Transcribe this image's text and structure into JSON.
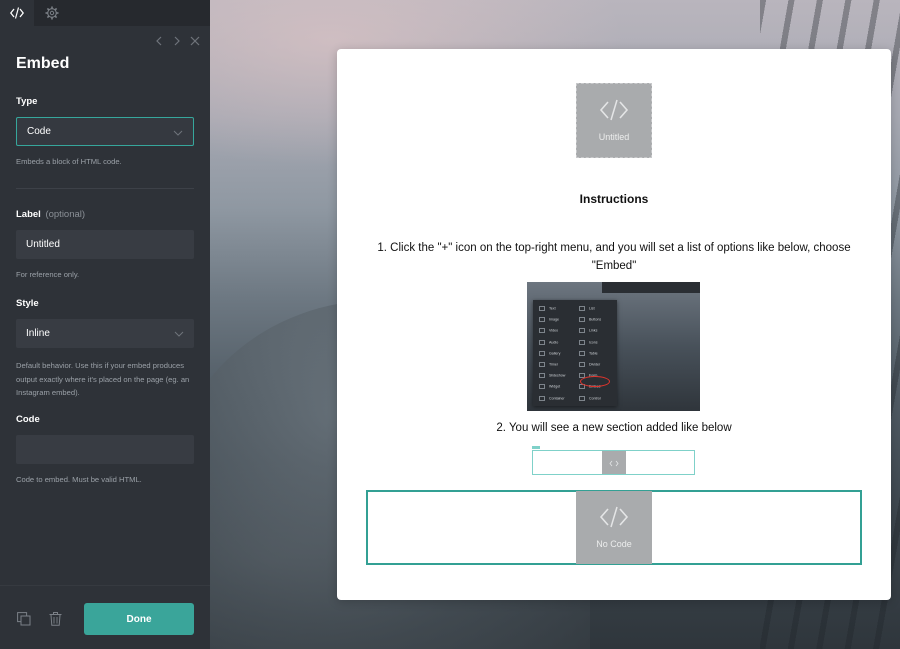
{
  "sidebar": {
    "tabs": [
      {
        "icon": "code-icon"
      },
      {
        "icon": "gear-icon"
      }
    ],
    "nav": {
      "prev_icon": "chevron-left-icon",
      "next_icon": "chevron-right-icon",
      "close_icon": "close-icon"
    },
    "title": "Embed",
    "type": {
      "label": "Type",
      "value": "Code",
      "help": "Embeds a block of HTML code."
    },
    "label_field": {
      "label": "Label",
      "optional": "(optional)",
      "value": "Untitled",
      "help": "For reference only."
    },
    "style": {
      "label": "Style",
      "value": "Inline",
      "help": "Default behavior. Use this if your embed produces output exactly where it's placed on the page (eg. an Instagram embed)."
    },
    "code": {
      "label": "Code",
      "value": "",
      "help": "Code to embed. Must be valid HTML."
    },
    "footer": {
      "duplicate_icon": "duplicate-icon",
      "delete_icon": "trash-icon",
      "done_label": "Done"
    }
  },
  "preview": {
    "top_thumb_label": "Untitled",
    "instructions_title": "Instructions",
    "step1": "1. Click the \"+\" icon on the top-right menu, and you will set a list of options like below, choose \"Embed\"",
    "menu_items": [
      {
        "left": "Text",
        "right": "List"
      },
      {
        "left": "Image",
        "right": "Buttons"
      },
      {
        "left": "Video",
        "right": "Links"
      },
      {
        "left": "Audio",
        "right": "Icons"
      },
      {
        "left": "Gallery",
        "right": "Table"
      },
      {
        "left": "Timer",
        "right": "Divider"
      },
      {
        "left": "Slideshow",
        "right": "Form"
      },
      {
        "left": "Widget",
        "right": "Embed"
      },
      {
        "left": "Container",
        "right": "Control"
      }
    ],
    "step2": "2. You will see a new section added like below",
    "bottom_thumb_label": "No Code"
  },
  "colors": {
    "accent": "#3aa59a",
    "sidebar_bg": "#2e3238",
    "field_bg": "#383c43"
  }
}
